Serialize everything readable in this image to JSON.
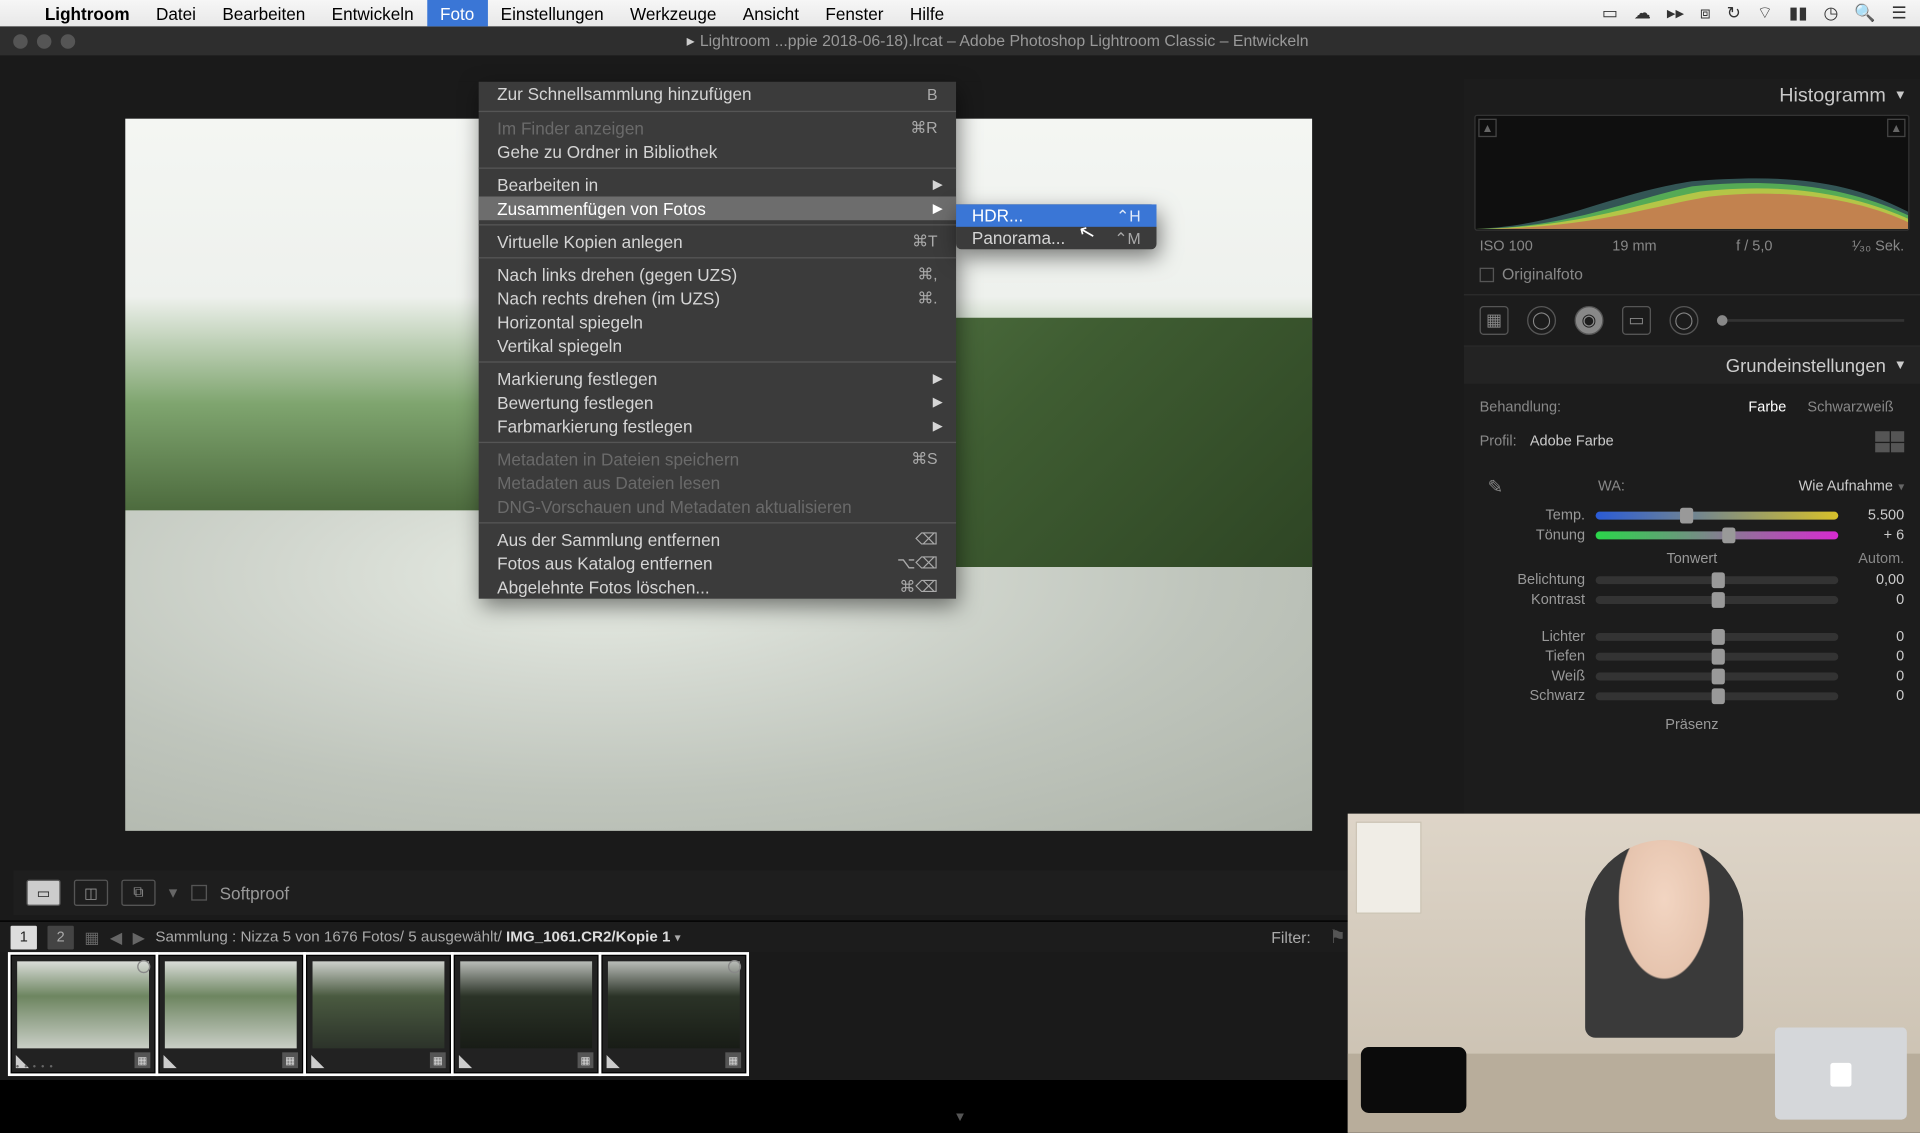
{
  "menubar": {
    "app": "Lightroom",
    "items": [
      "Datei",
      "Bearbeiten",
      "Entwickeln",
      "Foto",
      "Einstellungen",
      "Werkzeuge",
      "Ansicht",
      "Fenster",
      "Hilfe"
    ],
    "active_index": 3
  },
  "titlebar": "Lightroom ...ppie 2018-06-18).lrcat – Adobe Photoshop Lightroom Classic – Entwickeln",
  "menu": {
    "items": [
      {
        "label": "Zur Schnellsammlung hinzufügen",
        "shortcut": "B"
      },
      {
        "sep": true
      },
      {
        "label": "Im Finder anzeigen",
        "shortcut": "⌘R",
        "disabled": true
      },
      {
        "label": "Gehe zu Ordner in Bibliothek"
      },
      {
        "sep": true
      },
      {
        "label": "Bearbeiten in",
        "submenu": true
      },
      {
        "label": "Zusammenfügen von Fotos",
        "submenu": true,
        "highlight": true
      },
      {
        "sep": true
      },
      {
        "label": "Virtuelle Kopien anlegen",
        "shortcut": "⌘T"
      },
      {
        "sep": true
      },
      {
        "label": "Nach links drehen (gegen UZS)",
        "shortcut": "⌘,"
      },
      {
        "label": "Nach rechts drehen (im UZS)",
        "shortcut": "⌘."
      },
      {
        "label": "Horizontal spiegeln"
      },
      {
        "label": "Vertikal spiegeln"
      },
      {
        "sep": true
      },
      {
        "label": "Markierung festlegen",
        "submenu": true
      },
      {
        "label": "Bewertung festlegen",
        "submenu": true
      },
      {
        "label": "Farbmarkierung festlegen",
        "submenu": true
      },
      {
        "sep": true
      },
      {
        "label": "Metadaten in Dateien speichern",
        "shortcut": "⌘S",
        "disabled": true
      },
      {
        "label": "Metadaten aus Dateien lesen",
        "disabled": true
      },
      {
        "label": "DNG-Vorschauen und Metadaten aktualisieren",
        "disabled": true
      },
      {
        "sep": true
      },
      {
        "label": "Aus der Sammlung entfernen",
        "shortcut": "⌫"
      },
      {
        "label": "Fotos aus Katalog entfernen",
        "shortcut": "⌥⌫"
      },
      {
        "label": "Abgelehnte Fotos löschen...",
        "shortcut": "⌘⌫"
      }
    ]
  },
  "submenu": {
    "items": [
      {
        "label": "HDR...",
        "shortcut": "⌃H",
        "highlight": true
      },
      {
        "label": "Panorama...",
        "shortcut": "⌃M"
      }
    ]
  },
  "right": {
    "histogram_title": "Histogramm",
    "meta": {
      "iso": "ISO 100",
      "focal": "19 mm",
      "aperture": "f / 5,0",
      "shutter": "¹⁄₃₀ Sek."
    },
    "originalfoto": "Originalfoto",
    "basic_title": "Grundeinstellungen",
    "treatment_label": "Behandlung:",
    "treatment_color": "Farbe",
    "treatment_bw": "Schwarzweiß",
    "profile_label": "Profil:",
    "profile_value": "Adobe Farbe",
    "wb_label": "WA:",
    "wb_value": "Wie Aufnahme",
    "temp_label": "Temp.",
    "temp_value": "5.500",
    "tint_label": "Tönung",
    "tint_value": "+ 6",
    "tone_title": "Tonwert",
    "auto_label": "Autom.",
    "exposure_label": "Belichtung",
    "exposure_value": "0,00",
    "contrast_label": "Kontrast",
    "contrast_value": "0",
    "highlights_label": "Lichter",
    "highlights_value": "0",
    "shadows_label": "Tiefen",
    "shadows_value": "0",
    "whites_label": "Weiß",
    "whites_value": "0",
    "blacks_label": "Schwarz",
    "blacks_value": "0",
    "presence_title": "Präsenz"
  },
  "imgbar": {
    "softproof": "Softproof"
  },
  "fsbar": {
    "page1": "1",
    "page2": "2",
    "info": "Sammlung : Nizza   5 von 1676 Fotos/  5 ausgewählt/",
    "filename": "IMG_1061.CR2/Kopie 1",
    "filter": "Filter:"
  }
}
